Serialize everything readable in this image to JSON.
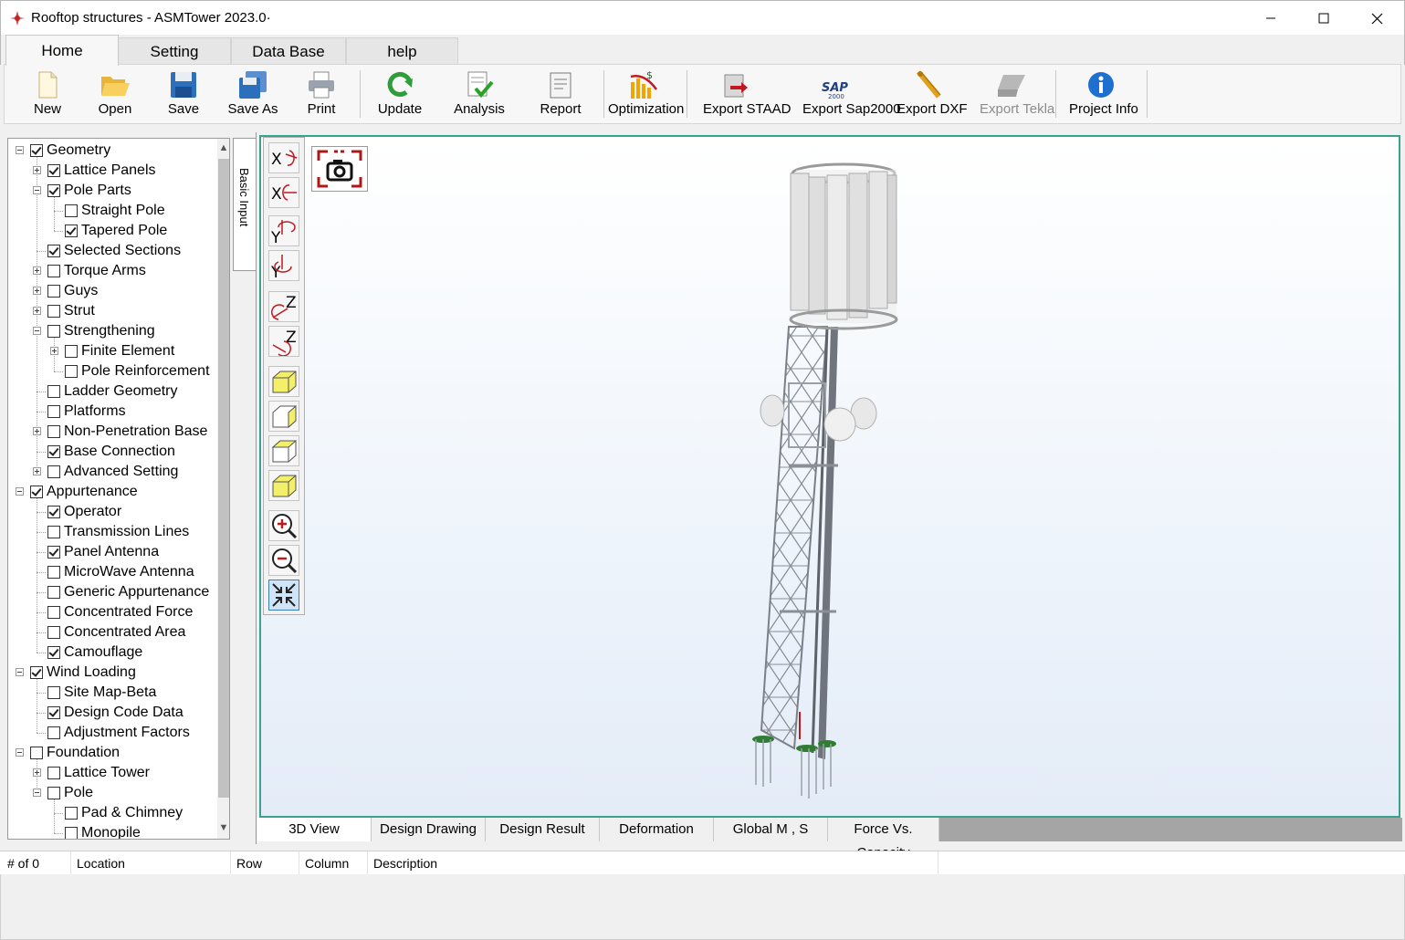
{
  "window": {
    "title": "Rooftop structures - ASMTower 2023.0·",
    "minimize": "minimize",
    "maximize": "maximize",
    "close": "close"
  },
  "menu_tabs": [
    "Home",
    "Setting",
    "Data Base",
    "help"
  ],
  "ribbon": {
    "new": "New",
    "open": "Open",
    "save": "Save",
    "save_as": "Save As",
    "print": "Print",
    "update": "Update",
    "analysis": "Analysis",
    "report": "Report",
    "optimization": "Optimization",
    "export_staad": "Export STAAD",
    "export_sap": "Export Sap2000",
    "export_dxf": "Export DXF",
    "export_tekla": "Export Tekla",
    "project_info": "Project Info"
  },
  "side_tab": "Basic Input",
  "tree": [
    {
      "label": "Geometry",
      "level": 0,
      "expander": "minus",
      "checked": true
    },
    {
      "label": "Lattice Panels",
      "level": 1,
      "expander": "plus",
      "checked": true
    },
    {
      "label": "Pole Parts",
      "level": 1,
      "expander": "minus",
      "checked": true
    },
    {
      "label": "Straight Pole",
      "level": 2,
      "expander": "",
      "checked": false
    },
    {
      "label": "Tapered Pole",
      "level": 2,
      "expander": "",
      "checked": true
    },
    {
      "label": "Selected Sections",
      "level": 1,
      "expander": "",
      "checked": true
    },
    {
      "label": "Torque Arms",
      "level": 1,
      "expander": "plus",
      "checked": false
    },
    {
      "label": "Guys",
      "level": 1,
      "expander": "plus",
      "checked": false
    },
    {
      "label": "Strut",
      "level": 1,
      "expander": "plus",
      "checked": false
    },
    {
      "label": "Strengthening",
      "level": 1,
      "expander": "minus",
      "checked": false
    },
    {
      "label": "Finite Element",
      "level": 2,
      "expander": "plus",
      "checked": false
    },
    {
      "label": "Pole Reinforcement",
      "level": 2,
      "expander": "",
      "checked": false
    },
    {
      "label": "Ladder Geometry",
      "level": 1,
      "expander": "",
      "checked": false
    },
    {
      "label": "Platforms",
      "level": 1,
      "expander": "",
      "checked": false
    },
    {
      "label": "Non-Penetration Base",
      "level": 1,
      "expander": "plus",
      "checked": false
    },
    {
      "label": "Base Connection",
      "level": 1,
      "expander": "",
      "checked": true
    },
    {
      "label": "Advanced Setting",
      "level": 1,
      "expander": "plus",
      "checked": false
    },
    {
      "label": "Appurtenance",
      "level": 0,
      "expander": "minus",
      "checked": true
    },
    {
      "label": "Operator",
      "level": 1,
      "expander": "",
      "checked": true
    },
    {
      "label": "Transmission Lines",
      "level": 1,
      "expander": "",
      "checked": false
    },
    {
      "label": "Panel Antenna",
      "level": 1,
      "expander": "",
      "checked": true
    },
    {
      "label": "MicroWave Antenna",
      "level": 1,
      "expander": "",
      "checked": false
    },
    {
      "label": "Generic Appurtenance",
      "level": 1,
      "expander": "",
      "checked": false
    },
    {
      "label": "Concentrated Force",
      "level": 1,
      "expander": "",
      "checked": false
    },
    {
      "label": "Concentrated Area",
      "level": 1,
      "expander": "",
      "checked": false
    },
    {
      "label": "Camouflage",
      "level": 1,
      "expander": "",
      "checked": true
    },
    {
      "label": "Wind Loading",
      "level": 0,
      "expander": "minus",
      "checked": true
    },
    {
      "label": "Site Map-Beta",
      "level": 1,
      "expander": "",
      "checked": false
    },
    {
      "label": "Design Code Data",
      "level": 1,
      "expander": "",
      "checked": true
    },
    {
      "label": "Adjustment Factors",
      "level": 1,
      "expander": "",
      "checked": false
    },
    {
      "label": "Foundation",
      "level": 0,
      "expander": "minus",
      "checked": false
    },
    {
      "label": "Lattice Tower",
      "level": 1,
      "expander": "plus",
      "checked": false
    },
    {
      "label": "Pole",
      "level": 1,
      "expander": "minus",
      "checked": false
    },
    {
      "label": "Pad & Chimney",
      "level": 2,
      "expander": "",
      "checked": false
    },
    {
      "label": "Monopile",
      "level": 2,
      "expander": "",
      "checked": false
    }
  ],
  "view_tools": [
    "rotate-x-pos-icon",
    "rotate-x-neg-icon",
    "rotate-y-pos-icon",
    "rotate-y-neg-icon",
    "rotate-z-pos-icon",
    "rotate-z-neg-icon",
    "view-front-icon",
    "view-side-icon",
    "view-top-icon",
    "view-iso-icon",
    "zoom-in-icon",
    "zoom-out-icon",
    "fit-view-icon"
  ],
  "bottom_tabs": [
    "3D View",
    "Design Drawing",
    "Design Result",
    "Deformation",
    "Global M , S",
    "Force Vs. Capacity"
  ],
  "grid_columns": [
    "# of 0",
    "Location",
    "Row",
    "Column",
    "Description"
  ],
  "colors": {
    "viewport_border": "#3aa28a",
    "accent": "#1e6fd0",
    "error_red": "#c0191f"
  }
}
